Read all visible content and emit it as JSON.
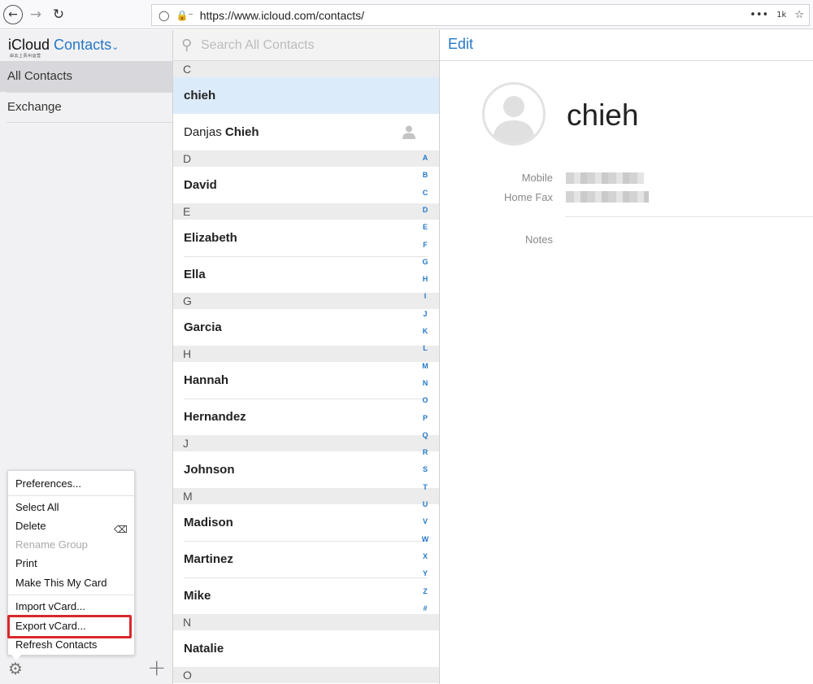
{
  "browser": {
    "url": "https://www.icloud.com/contacts/",
    "badge": "1k"
  },
  "app": {
    "brand": "iCloud",
    "name": "Contacts",
    "subtitle": "由云上贵州运营"
  },
  "groups": [
    {
      "label": "All Contacts",
      "selected": true
    },
    {
      "label": "Exchange",
      "selected": false
    }
  ],
  "menu": {
    "items": [
      {
        "label": "Preferences..."
      },
      {
        "label": "Select All"
      },
      {
        "label": "Delete"
      },
      {
        "label": "Rename Group",
        "disabled": true
      },
      {
        "label": "Print"
      },
      {
        "label": "Make This My Card"
      },
      {
        "label": "Import vCard..."
      },
      {
        "label": "Export vCard...",
        "highlighted": true
      },
      {
        "label": "Refresh Contacts"
      }
    ]
  },
  "search": {
    "placeholder": "Search All Contacts"
  },
  "sections": {
    "c": "C",
    "d": "D",
    "e": "E",
    "g": "G",
    "h": "H",
    "j": "J",
    "m": "M",
    "n": "N",
    "o": "O"
  },
  "contacts": {
    "chieh": "chieh",
    "danjas_first": "Danjas",
    "danjas_last": "Chieh",
    "david": "David",
    "elizabeth": "Elizabeth",
    "ella": "Ella",
    "garcia": "Garcia",
    "hannah": "Hannah",
    "hernandez": "Hernandez",
    "johnson": "Johnson",
    "madison": "Madison",
    "martinez": "Martinez",
    "mike": "Mike",
    "natalie": "Natalie"
  },
  "index_letters": [
    "A",
    "B",
    "C",
    "D",
    "E",
    "F",
    "G",
    "H",
    "I",
    "J",
    "K",
    "L",
    "M",
    "N",
    "O",
    "P",
    "Q",
    "R",
    "S",
    "T",
    "U",
    "V",
    "W",
    "X",
    "Y",
    "Z",
    "#"
  ],
  "detail": {
    "edit_label": "Edit",
    "name": "chieh",
    "mobile_label": "Mobile",
    "home_fax_label": "Home Fax",
    "notes_label": "Notes"
  },
  "colors": {
    "accent": "#2478c8",
    "selected_row": "#dcebfa",
    "highlight_box": "#d8282c"
  }
}
